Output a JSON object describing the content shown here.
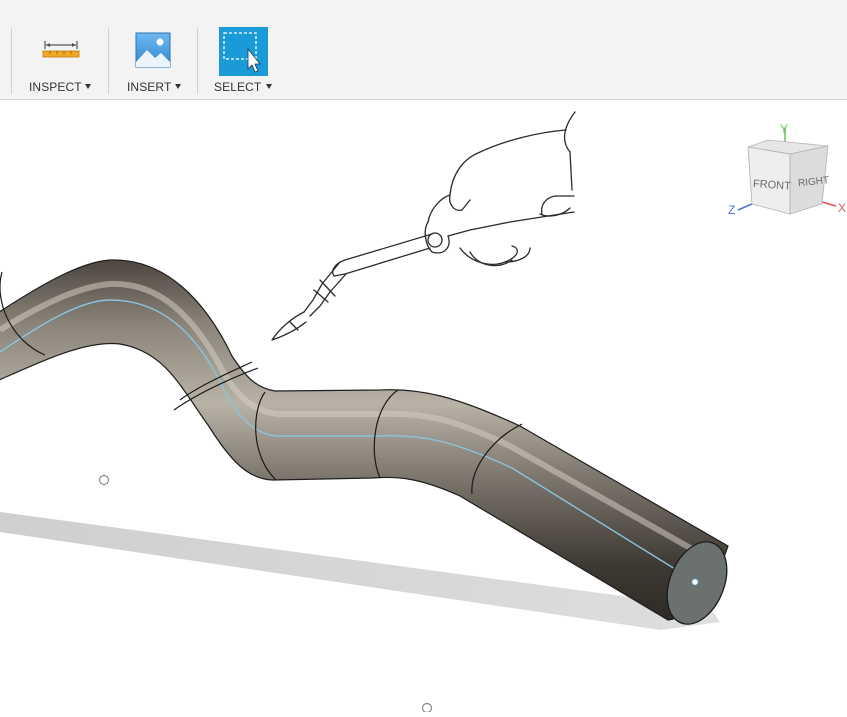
{
  "toolbar": {
    "inspect_label": "INSPECT",
    "insert_label": "INSERT",
    "select_label": "SELECT"
  },
  "viewcube": {
    "front_label": "FRONT",
    "right_label": "RIGHT",
    "axis_y": "Y",
    "axis_z": "Z",
    "axis_x": "X"
  },
  "icons": {
    "inspect": "measure-ruler-icon",
    "insert": "image-canvas-icon",
    "select": "selection-cursor-icon"
  },
  "colors": {
    "toolbar_bg": "#f3f3f3",
    "select_accent": "#1a9ad6",
    "tube_body": "#7d776e",
    "centerline": "#8cc4e0",
    "axis_x": "#e05555",
    "axis_y": "#6cc05a",
    "axis_z": "#4e74d8"
  }
}
